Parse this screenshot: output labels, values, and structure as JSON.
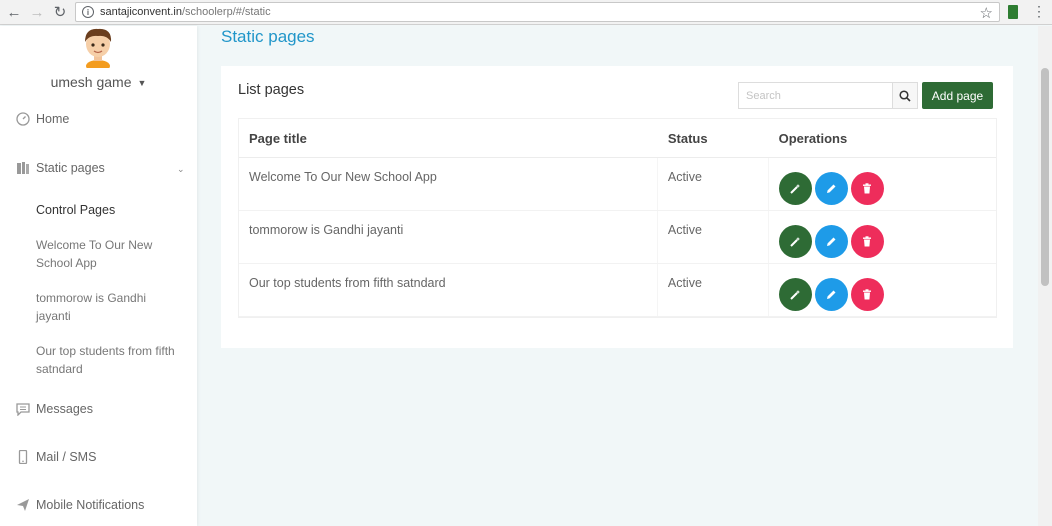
{
  "browser": {
    "url_host": "santajiconvent.in",
    "url_path": "/schoolerp/#/static"
  },
  "sidebar": {
    "user_name": "umesh game",
    "items": {
      "home": "Home",
      "static_pages": "Static pages",
      "messages": "Messages",
      "mail_sms": "Mail / SMS",
      "mobile_notifications": "Mobile Notifications"
    },
    "sub_items": [
      "Control Pages",
      "Welcome To Our New School App",
      "tommorow is Gandhi jayanti",
      "Our top students from fifth satndard"
    ]
  },
  "main": {
    "page_title": "Static pages",
    "card_title": "List pages",
    "search_placeholder": "Search",
    "add_button": "Add page",
    "columns": [
      "Page title",
      "Status",
      "Operations"
    ],
    "rows": [
      {
        "title": "Welcome To Our New School App",
        "status": "Active"
      },
      {
        "title": "tommorow is Gandhi jayanti",
        "status": "Active"
      },
      {
        "title": "Our top students from fifth satndard",
        "status": "Active"
      }
    ]
  },
  "colors": {
    "accent_blue": "#2196c9",
    "view_green": "#2e6b35",
    "edit_blue": "#1e9be8",
    "delete_pink": "#ee2d5b"
  }
}
